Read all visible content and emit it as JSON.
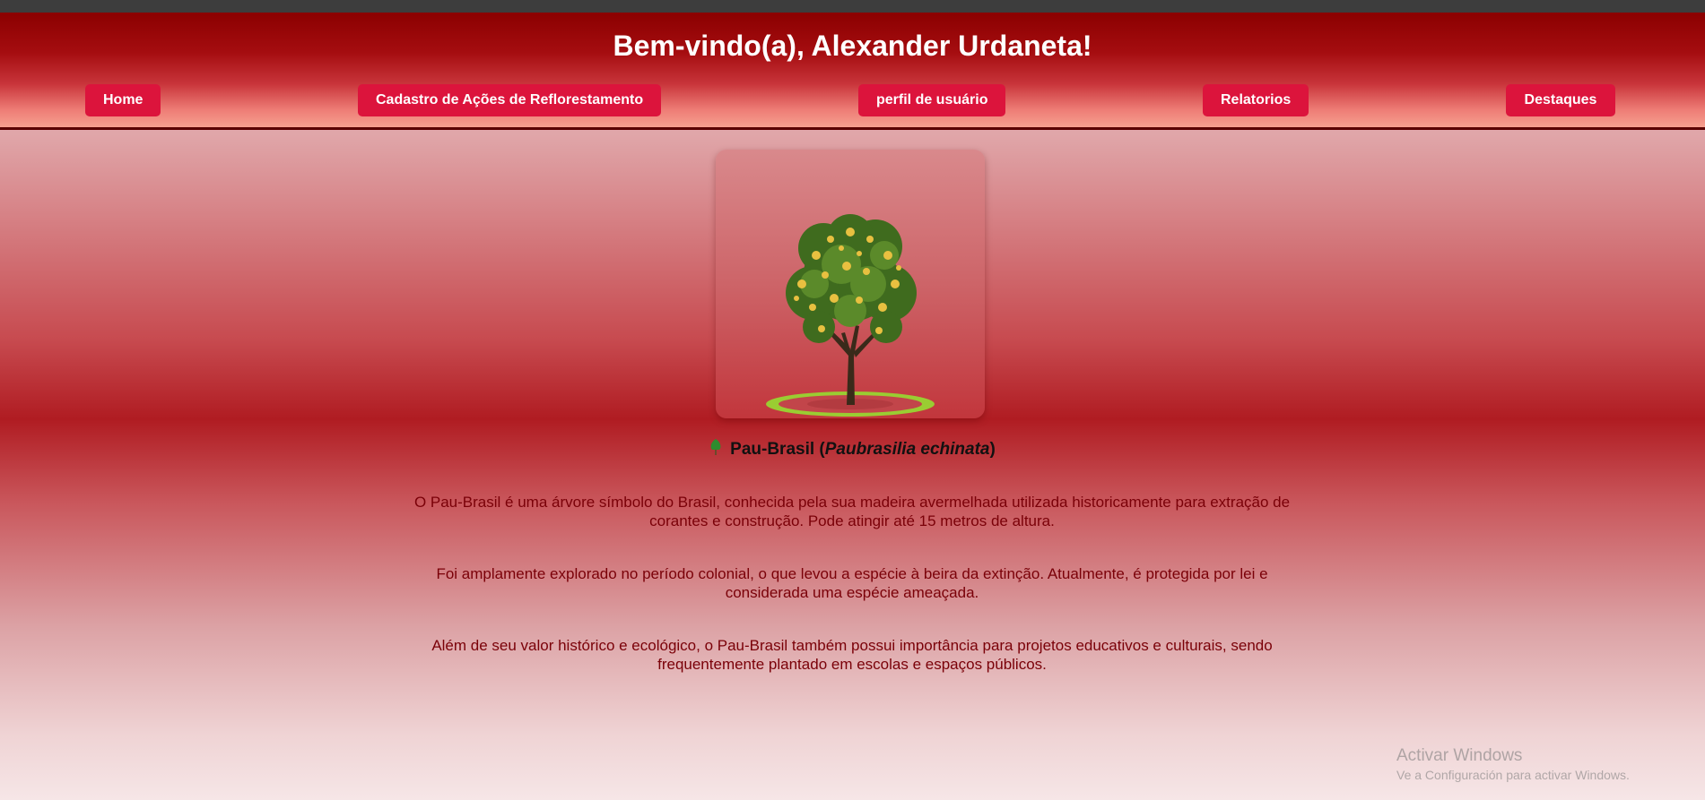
{
  "header": {
    "title": "Bem-vindo(a), Alexander Urdaneta!",
    "nav": [
      {
        "label": "Home"
      },
      {
        "label": "Cadastro de Ações de Reflorestamento"
      },
      {
        "label": "perfil de usuário"
      },
      {
        "label": "Relatorios"
      },
      {
        "label": "Destaques"
      }
    ]
  },
  "species": {
    "icon": "tree-icon",
    "common_name": "Pau-Brasil",
    "scientific_name": "Paubrasilia echinata",
    "open_paren": " (",
    "close_paren": ")"
  },
  "paragraphs": [
    "O Pau-Brasil é uma árvore símbolo do Brasil, conhecida pela sua madeira avermelhada utilizada historicamente para extração de corantes e construção. Pode atingir até 15 metros de altura.",
    "Foi amplamente explorado no período colonial, o que levou a espécie à beira da extinção. Atualmente, é protegida por lei e considerada uma espécie ameaçada.",
    "Além de seu valor histórico e ecológico, o Pau-Brasil também possui importância para projetos educativos e culturais, sendo frequentemente plantado em escolas e espaços públicos."
  ],
  "watermark": {
    "line1": "Activar Windows",
    "line2": "Ve a Configuración para activar Windows."
  },
  "colors": {
    "header_dark": "#8b0000",
    "button": "#dc143c",
    "text": "#7a0008"
  }
}
